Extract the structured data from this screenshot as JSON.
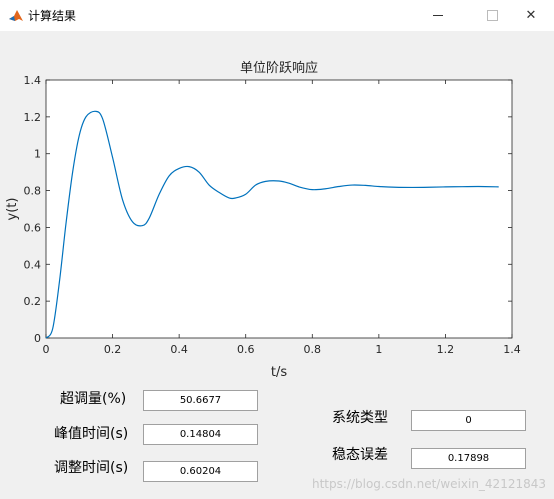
{
  "window": {
    "title": "计算结果",
    "icon": "matlab-icon",
    "controls": [
      "minimize-icon",
      "maximize-icon",
      "close-icon"
    ],
    "close_glyph": "✕"
  },
  "chart_data": {
    "type": "line",
    "title": "单位阶跃响应",
    "xlabel": "t/s",
    "ylabel": "y(t)",
    "xlim": [
      0,
      1.4
    ],
    "ylim": [
      0,
      1.4
    ],
    "xticks": [
      0,
      0.2,
      0.4,
      0.6,
      0.8,
      1,
      1.2,
      1.4
    ],
    "yticks": [
      0,
      0.2,
      0.4,
      0.6,
      0.8,
      1,
      1.2,
      1.4
    ],
    "grid": false,
    "line_color": "#0072bd",
    "series": [
      {
        "x": [
          0,
          0.02,
          0.04,
          0.06,
          0.08,
          0.1,
          0.12,
          0.148,
          0.17,
          0.2,
          0.23,
          0.26,
          0.29,
          0.31,
          0.34,
          0.37,
          0.4,
          0.43,
          0.46,
          0.49,
          0.52,
          0.55,
          0.57,
          0.6,
          0.63,
          0.66,
          0.7,
          0.73,
          0.76,
          0.8,
          0.84,
          0.88,
          0.92,
          0.96,
          1.0,
          1.05,
          1.1,
          1.15,
          1.2,
          1.25,
          1.3,
          1.36
        ],
        "y": [
          0,
          0.05,
          0.3,
          0.62,
          0.9,
          1.1,
          1.2,
          1.23,
          1.19,
          0.98,
          0.75,
          0.63,
          0.61,
          0.65,
          0.78,
          0.88,
          0.92,
          0.93,
          0.9,
          0.83,
          0.79,
          0.76,
          0.76,
          0.78,
          0.83,
          0.85,
          0.852,
          0.84,
          0.82,
          0.805,
          0.81,
          0.822,
          0.83,
          0.828,
          0.822,
          0.818,
          0.817,
          0.818,
          0.82,
          0.821,
          0.822,
          0.82
        ]
      }
    ]
  },
  "results": {
    "overshoot_label": "超调量(%)",
    "overshoot_value": "50.6677",
    "peak_time_label": "峰值时间(s)",
    "peak_time_value": "0.14804",
    "settling_time_label": "调整时间(s)",
    "settling_time_value": "0.60204",
    "system_type_label": "系统类型",
    "system_type_value": "0",
    "steady_error_label": "稳态误差",
    "steady_error_value": "0.17898"
  },
  "watermark": "https://blog.csdn.net/weixin_42121843"
}
